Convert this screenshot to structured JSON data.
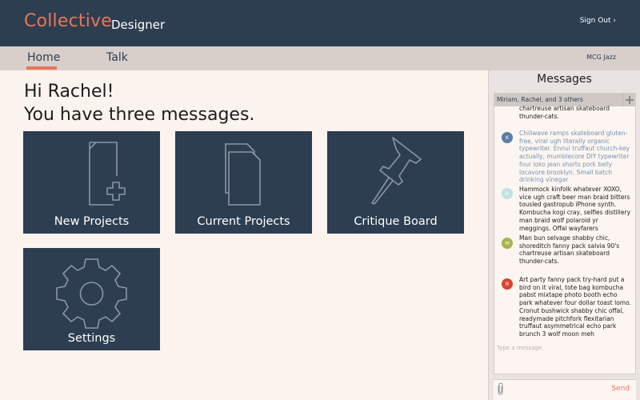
{
  "header": {
    "brand": "Collective",
    "role": "Designer",
    "sign_out": "Sign Out ›"
  },
  "nav": {
    "tabs": [
      {
        "label": "Home",
        "active": true
      },
      {
        "label": "Talk",
        "active": false
      }
    ],
    "right_label": "MCG Jazz"
  },
  "greeting": {
    "line1": "Hi Rachel!",
    "line2": "You have three messages."
  },
  "tiles": [
    {
      "label": "New Projects",
      "icon": "new-document-icon"
    },
    {
      "label": "Current Projects",
      "icon": "documents-icon"
    },
    {
      "label": "Critique Board",
      "icon": "pushpin-icon"
    },
    {
      "label": "Settings",
      "icon": "gear-icon"
    }
  ],
  "messages_panel": {
    "title": "Messages",
    "thread_title": "Miriam, Rachel, and 3 others",
    "messages": [
      {
        "avatar": "",
        "text": "chartreuse artisan skateboard thunder-cats.",
        "style": "dark"
      },
      {
        "avatar": "K",
        "avatar_color": "#5a7fa6",
        "text": "Chillwave ramps skateboard gluten-free, viral ugh literally organic typewriter.  Ennui truffaut church-key actually, mumblecore DIY typewriter four loko jean shorts pork belly locavore brooklyn. Small batch drinking vinegar",
        "style": "light"
      },
      {
        "avatar": "R",
        "avatar_color": "#bfe3df",
        "text": "Hammock kinfolk whatever XOXO, vice ugh craft beer man braid bitters tousled gastropub iPhone synth. Kombucha kogi cray, selfies distillery man braid wolf polaroid yr meggings. Offal wayfarers",
        "style": "dark"
      },
      {
        "avatar": "M",
        "avatar_color": "#a8b24a",
        "text": "Man bun selvage shabby chic, shoreditch fanny pack salvia 90's chartreuse artisan skateboard thunder-cats.",
        "style": "dark"
      },
      {
        "avatar": "R",
        "avatar_color": "#d9442e",
        "text": "Art party fanny pack try-hard put a bird on it viral, tote bag kombucha pabst mixtape photo booth echo park whatever four dollar toast lomo. Cronut bushwick shabby chic offal, readymade pitchfork flexitarian truffaut asymmetrical echo park brunch 3 wolf moon meh",
        "style": "dark"
      }
    ],
    "input_placeholder": "Type a message",
    "send_label": "Send"
  }
}
